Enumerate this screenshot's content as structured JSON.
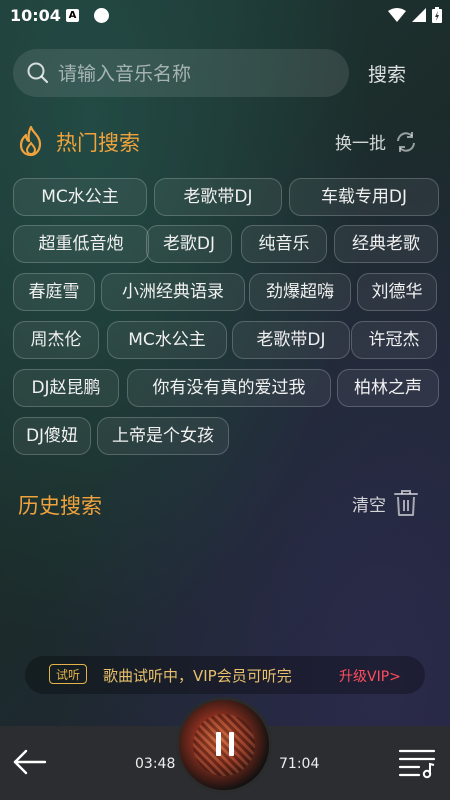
{
  "status": {
    "time": "10:04",
    "notif_letter": "A"
  },
  "search": {
    "placeholder": "请输入音乐名称",
    "button_label": "搜索"
  },
  "hot": {
    "title": "热门搜索",
    "refresh_label": "换一批",
    "tags": [
      "MC水公主",
      "老歌带DJ",
      "车载专用DJ",
      "超重低音炮",
      "老歌DJ",
      "纯音乐",
      "经典老歌",
      "春庭雪",
      "小洲经典语录",
      "劲爆超嗨",
      "刘德华",
      "周杰伦",
      "MC水公主",
      "老歌带DJ",
      "许冠杰",
      "DJ赵昆鹏",
      "你有没有真的爱过我",
      "柏林之声",
      "DJ傻妞",
      "上帝是个女孩"
    ]
  },
  "history": {
    "title": "历史搜索",
    "clear_label": "清空"
  },
  "vip_banner": {
    "badge": "试听",
    "text": "歌曲试听中，VIP会员可听完",
    "upgrade": "升级VIP>"
  },
  "player": {
    "current_time": "03:48",
    "total_time": "71:04"
  },
  "colors": {
    "accent": "#f0a33c",
    "vip": "#e6c06a",
    "upgrade": "#ff4d5c"
  }
}
